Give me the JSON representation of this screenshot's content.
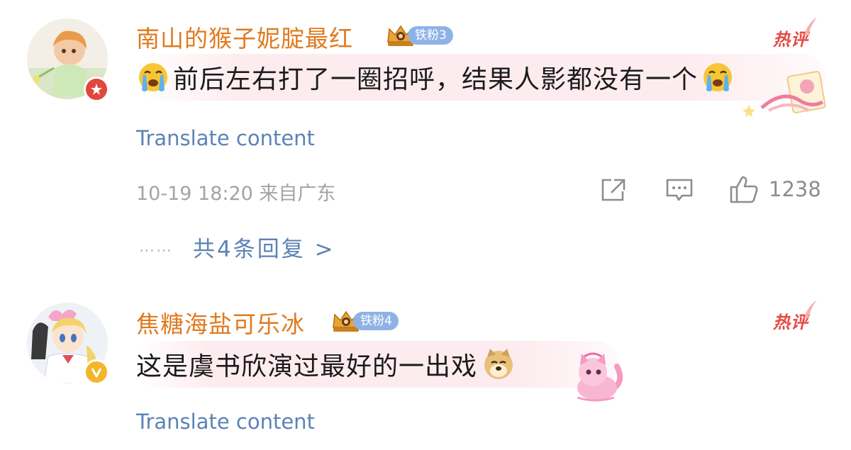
{
  "comments": [
    {
      "username": "南山的猴子妮腚最红",
      "fan_badge": "铁粉3",
      "hot_tag": "热评",
      "text": "前后左右打了一圈招呼，结果人影都没有一个",
      "translate_label": "Translate content",
      "timestamp": "10-19 18:20 来自广东",
      "like_count": "1238",
      "replies_label": "共4条回复 >",
      "avatar_badge_icon": "red-star-badge-icon",
      "emoji_icon": "crying-face-emoji-icon",
      "sticker_icon": "pink-ribbon-card-sticker-icon"
    },
    {
      "username": "焦糖海盐可乐冰",
      "fan_badge": "铁粉4",
      "hot_tag": "热评",
      "text": "这是虞书欣演过最好的一出戏",
      "translate_label": "Translate content",
      "avatar_badge_icon": "yellow-verified-v-badge-icon",
      "emoji_icon": "doge-emoji-icon",
      "sticker_icon": "pink-cat-sticker-icon"
    }
  ],
  "colors": {
    "username": "#e07a1f",
    "link": "#5b83b6",
    "hot_tag": "#e64a44",
    "fan_badge": "#8fb2e6",
    "bubble": "#fdecef",
    "meta": "#a4a4a4"
  }
}
